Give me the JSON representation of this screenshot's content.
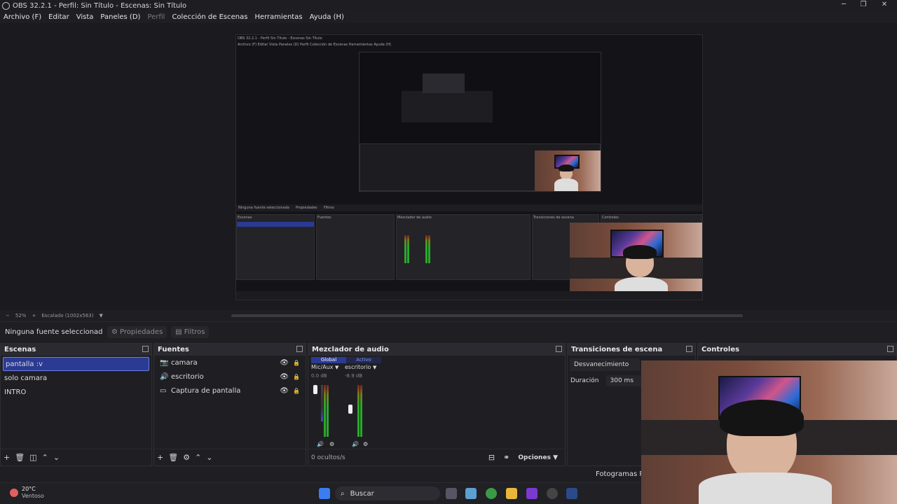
{
  "window": {
    "title": "OBS 32.2.1 - Perfil: Sin Título - Escenas: Sin Título"
  },
  "menu": [
    "Archivo (F)",
    "Editar",
    "Vista",
    "Paneles (D)",
    "Perfil",
    "Colección de Escenas",
    "Herramientas",
    "Ayuda (H)"
  ],
  "preview": {
    "zoom": "52%",
    "scaling": "Escalado (1002x563)",
    "nested_title": "OBS 32.2.1 - Perfil Sin Título - Escenas Sin Título",
    "nested_no_source": "Ninguna fuente seleccionada",
    "nested_properties": "Propiedades",
    "nested_filters": "Filtros",
    "nested_scenes": "Escenas",
    "nested_sources": "Fuentes",
    "nested_mixer": "Mezclador de audio",
    "nested_transitions": "Transiciones de escena",
    "nested_controls": "Controles"
  },
  "source_toolbar": {
    "no_source": "Ninguna fuente seleccionada",
    "properties": "Propiedades",
    "filters": "Filtros"
  },
  "scenes": {
    "title": "Escenas",
    "items": [
      "pantalla :v",
      "solo camara",
      "INTRO"
    ]
  },
  "sources": {
    "title": "Fuentes",
    "items": [
      {
        "label": "camara",
        "icon": "camera-icon"
      },
      {
        "label": "escritorio",
        "icon": "speaker-icon"
      },
      {
        "label": "Captura de pantalla",
        "icon": "monitor-icon"
      }
    ]
  },
  "mixer": {
    "title": "Mezclador de audio",
    "tabs": [
      "Global",
      "Activo"
    ],
    "channels": [
      {
        "name": "Mic/Aux",
        "db": "0.0 dB"
      },
      {
        "name": "escritorio",
        "db": "-8.9 dB"
      }
    ],
    "hidden": "0 ocultos/s",
    "options": "Opciones"
  },
  "transitions": {
    "title": "Transiciones de escena",
    "type": "Desvanecimiento",
    "duration_label": "Duración",
    "duration_value": "300 ms"
  },
  "controls": {
    "title": "Controles"
  },
  "status": {
    "fps_label": "Fotogramas Per"
  },
  "taskbar": {
    "temperature": "20°C",
    "weather": "Ventoso",
    "search": "Buscar"
  },
  "colors": {
    "accent": "#2b3a93",
    "panel": "#1f1f23",
    "header": "#2a2a30"
  }
}
